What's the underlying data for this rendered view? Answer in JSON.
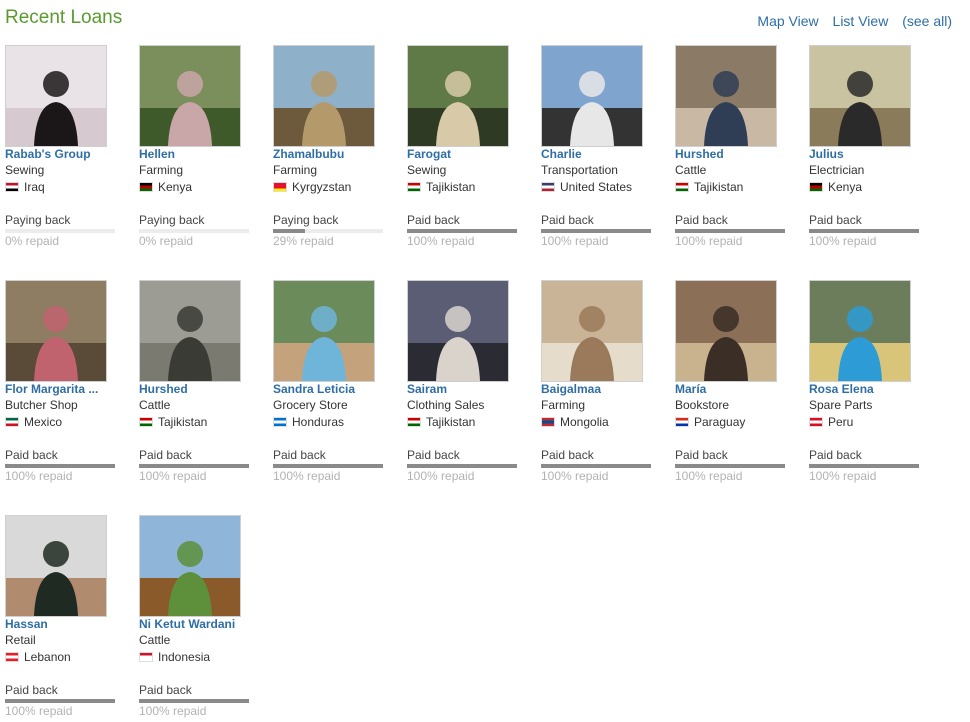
{
  "header": {
    "title": "Recent Loans",
    "map_view": "Map View",
    "list_view": "List View",
    "see_all": "(see all)"
  },
  "loans": [
    {
      "name": "Rabab's Group",
      "sector": "Sewing",
      "country": "Iraq",
      "status": "Paying back",
      "repaid_label": "0% repaid",
      "repaid_fraction": 0.0,
      "flag_colors": [
        "#c8102e",
        "#ffffff",
        "#000000"
      ],
      "photo_colors": [
        "#e9e2e6",
        "#1b1719",
        "#d6c9cf"
      ]
    },
    {
      "name": "Hellen",
      "sector": "Farming",
      "country": "Kenya",
      "status": "Paying back",
      "repaid_label": "0% repaid",
      "repaid_fraction": 0.0,
      "flag_colors": [
        "#000000",
        "#bb0000",
        "#006600"
      ],
      "photo_colors": [
        "#7a8f5c",
        "#c9a6a8",
        "#3e5a2a"
      ]
    },
    {
      "name": "Zhamalbubu",
      "sector": "Farming",
      "country": "Kyrgyzstan",
      "status": "Paying back",
      "repaid_label": "29% repaid",
      "repaid_fraction": 0.29,
      "flag_colors": [
        "#e8112d",
        "#e8112d",
        "#ffef00"
      ],
      "photo_colors": [
        "#8fb0c9",
        "#b49a6a",
        "#6d5a3c"
      ]
    },
    {
      "name": "Farogat",
      "sector": "Sewing",
      "country": "Tajikistan",
      "status": "Paid back",
      "repaid_label": "100% repaid",
      "repaid_fraction": 1.0,
      "flag_colors": [
        "#cc0000",
        "#ffffff",
        "#006600"
      ],
      "photo_colors": [
        "#5f7a46",
        "#d8c9a8",
        "#2e3a24"
      ]
    },
    {
      "name": "Charlie",
      "sector": "Transportation",
      "country": "United States",
      "status": "Paid back",
      "repaid_label": "100% repaid",
      "repaid_fraction": 1.0,
      "flag_colors": [
        "#3c3b6e",
        "#ffffff",
        "#b22234"
      ],
      "photo_colors": [
        "#7fa5cf",
        "#e7e7e7",
        "#333333"
      ]
    },
    {
      "name": "Hurshed",
      "sector": "Cattle",
      "country": "Tajikistan",
      "status": "Paid back",
      "repaid_label": "100% repaid",
      "repaid_fraction": 1.0,
      "flag_colors": [
        "#cc0000",
        "#ffffff",
        "#006600"
      ],
      "photo_colors": [
        "#8a7a66",
        "#2f3e55",
        "#c9b9a4"
      ]
    },
    {
      "name": "Julius",
      "sector": "Electrician",
      "country": "Kenya",
      "status": "Paid back",
      "repaid_label": "100% repaid",
      "repaid_fraction": 1.0,
      "flag_colors": [
        "#000000",
        "#bb0000",
        "#006600"
      ],
      "photo_colors": [
        "#c9c3a2",
        "#2a2a2a",
        "#8a7b5a"
      ]
    },
    {
      "name": "Flor Margarita ...",
      "sector": "Butcher Shop",
      "country": "Mexico",
      "status": "Paid back",
      "repaid_label": "100% repaid",
      "repaid_fraction": 1.0,
      "flag_colors": [
        "#006847",
        "#ffffff",
        "#ce1126"
      ],
      "photo_colors": [
        "#8e7c63",
        "#c1636e",
        "#5a4a38"
      ]
    },
    {
      "name": "Hurshed",
      "sector": "Cattle",
      "country": "Tajikistan",
      "status": "Paid back",
      "repaid_label": "100% repaid",
      "repaid_fraction": 1.0,
      "flag_colors": [
        "#cc0000",
        "#ffffff",
        "#006600"
      ],
      "photo_colors": [
        "#9c9c94",
        "#3b3b36",
        "#7a7a70"
      ]
    },
    {
      "name": "Sandra Leticia",
      "sector": "Grocery Store",
      "country": "Honduras",
      "status": "Paid back",
      "repaid_label": "100% repaid",
      "repaid_fraction": 1.0,
      "flag_colors": [
        "#0073cf",
        "#ffffff",
        "#0073cf"
      ],
      "photo_colors": [
        "#6b8c5a",
        "#6fb4d9",
        "#c4a37c"
      ]
    },
    {
      "name": "Sairam",
      "sector": "Clothing Sales",
      "country": "Tajikistan",
      "status": "Paid back",
      "repaid_label": "100% repaid",
      "repaid_fraction": 1.0,
      "flag_colors": [
        "#cc0000",
        "#ffffff",
        "#006600"
      ],
      "photo_colors": [
        "#5a5d73",
        "#d9d3cc",
        "#2b2b33"
      ]
    },
    {
      "name": "Baigalmaa",
      "sector": "Farming",
      "country": "Mongolia",
      "status": "Paid back",
      "repaid_label": "100% repaid",
      "repaid_fraction": 1.0,
      "flag_colors": [
        "#c4272f",
        "#015197",
        "#c4272f"
      ],
      "photo_colors": [
        "#c9b497",
        "#9a7a5a",
        "#e6dccb"
      ]
    },
    {
      "name": "María",
      "sector": "Bookstore",
      "country": "Paraguay",
      "status": "Paid back",
      "repaid_label": "100% repaid",
      "repaid_fraction": 1.0,
      "flag_colors": [
        "#d52b1e",
        "#ffffff",
        "#0038a8"
      ],
      "photo_colors": [
        "#8b6f56",
        "#3a2e26",
        "#c9b38f"
      ]
    },
    {
      "name": "Rosa Elena",
      "sector": "Spare Parts",
      "country": "Peru",
      "status": "Paid back",
      "repaid_label": "100% repaid",
      "repaid_fraction": 1.0,
      "flag_colors": [
        "#d91023",
        "#ffffff",
        "#d91023"
      ],
      "photo_colors": [
        "#6b7d5a",
        "#2c9bd6",
        "#d8c57a"
      ]
    },
    {
      "name": "Hassan",
      "sector": "Retail",
      "country": "Lebanon",
      "status": "Paid back",
      "repaid_label": "100% repaid",
      "repaid_fraction": 1.0,
      "flag_colors": [
        "#ed1c24",
        "#ffffff",
        "#ed1c24"
      ],
      "photo_colors": [
        "#d9d9d9",
        "#1f2a22",
        "#b08b6e"
      ]
    },
    {
      "name": "Ni Ketut Wardani",
      "sector": "Cattle",
      "country": "Indonesia",
      "status": "Paid back",
      "repaid_label": "100% repaid",
      "repaid_fraction": 1.0,
      "flag_colors": [
        "#ce1126",
        "#ffffff",
        "#ffffff"
      ],
      "photo_colors": [
        "#8fb6d9",
        "#5e8f3a",
        "#8a5a2a"
      ]
    }
  ]
}
